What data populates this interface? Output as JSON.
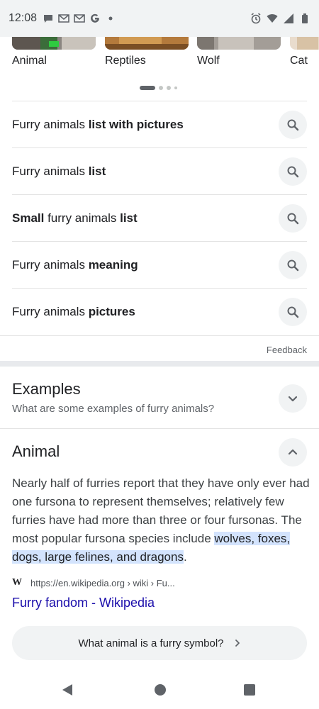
{
  "status_bar": {
    "time": "12:08",
    "left_icons": [
      "chat-bubble-icon",
      "gmail-icon",
      "gmail-icon",
      "google-g-icon",
      "dot-icon"
    ],
    "right_icons": [
      "alarm-icon",
      "wifi-icon",
      "signal-icon",
      "battery-icon"
    ]
  },
  "carousel": {
    "items": [
      {
        "label": "Animal"
      },
      {
        "label": "Reptiles"
      },
      {
        "label": "Wolf"
      },
      {
        "label": "Cat"
      }
    ],
    "page_count": 4,
    "active_page": 1
  },
  "related_searches": [
    {
      "parts": [
        {
          "t": "Furry animals ",
          "b": false
        },
        {
          "t": "list with pictures",
          "b": true
        }
      ]
    },
    {
      "parts": [
        {
          "t": "Furry animals ",
          "b": false
        },
        {
          "t": "list",
          "b": true
        }
      ]
    },
    {
      "parts": [
        {
          "t": "Small",
          "b": true
        },
        {
          "t": " furry animals ",
          "b": false
        },
        {
          "t": "list",
          "b": true
        }
      ]
    },
    {
      "parts": [
        {
          "t": "Furry animals ",
          "b": false
        },
        {
          "t": "meaning",
          "b": true
        }
      ]
    },
    {
      "parts": [
        {
          "t": "Furry animals ",
          "b": false
        },
        {
          "t": "pictures",
          "b": true
        }
      ]
    }
  ],
  "feedback_label": "Feedback",
  "examples": {
    "title": "Examples",
    "subtitle": "What are some examples of furry animals?"
  },
  "animal": {
    "title": "Animal",
    "answer_text": "Nearly half of furries report that they have only ever had one fursona to represent themselves; relatively few furries have had more than three or four fursonas. The most popular fursona species include ",
    "answer_highlight": "wolves, foxes, dogs, large felines, and dragons",
    "answer_end": ".",
    "source_logo": "W",
    "source_url": "https://en.wikipedia.org › wiki › Fu...",
    "source_title": "Furry fandom - Wikipedia"
  },
  "follow_up": {
    "label": "What animal is a furry symbol?"
  },
  "colors": {
    "link": "#1a0dab",
    "highlight": "#d3e3fd",
    "chip_bg": "#f1f3f4"
  }
}
